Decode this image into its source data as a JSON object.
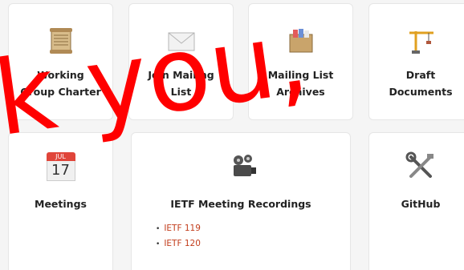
{
  "cards": [
    {
      "title": "Working Group Charter",
      "icon": "scroll-icon"
    },
    {
      "title": "Join Mailing List",
      "icon": "envelope-icon"
    },
    {
      "title": "Mailing List Archives",
      "icon": "file-cabinet-icon"
    },
    {
      "title": "Draft Documents",
      "icon": "construction-crane-icon"
    },
    {
      "title": "Meetings",
      "icon": "calendar-icon",
      "calendar_month": "JUL",
      "calendar_day": "17"
    },
    {
      "title": "IETF Meeting Recordings",
      "icon": "film-projector-icon",
      "links": [
        "IETF 119",
        "IETF 120"
      ]
    },
    {
      "title": "GitHub",
      "icon": "tools-icon"
    }
  ],
  "overlay_text": "k you,",
  "colors": {
    "link": "#c23d1c",
    "overlay": "#ff0000",
    "card_bg": "#ffffff"
  }
}
